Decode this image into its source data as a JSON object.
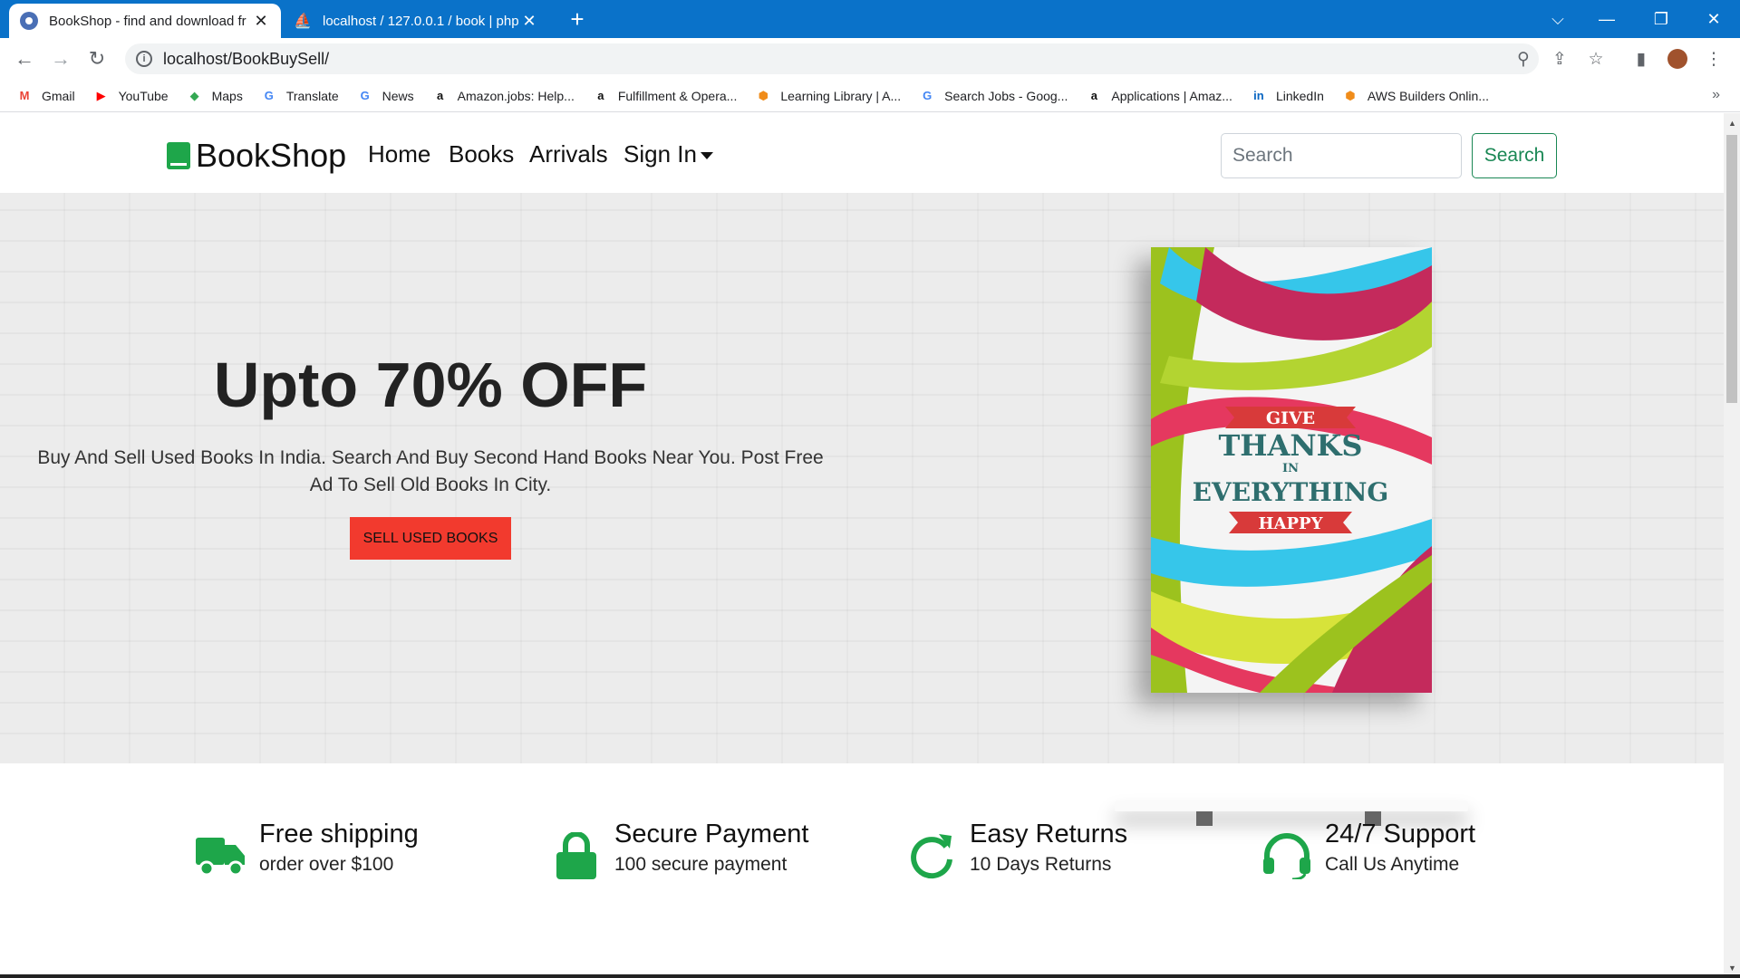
{
  "browser": {
    "tabs": [
      {
        "title": "BookShop - find and download fr",
        "active": true
      },
      {
        "title": "localhost / 127.0.0.1 / book | php",
        "active": false
      }
    ],
    "new_tab": "+",
    "close_glyph": "✕",
    "url": "localhost/BookBuySell/",
    "bookmarks": [
      {
        "label": "Gmail",
        "icon": "gmail-icon",
        "glyph": "M",
        "color": "#ea4335"
      },
      {
        "label": "YouTube",
        "icon": "youtube-icon",
        "glyph": "▶",
        "color": "#ff0000"
      },
      {
        "label": "Maps",
        "icon": "maps-icon",
        "glyph": "◆",
        "color": "#34a853"
      },
      {
        "label": "Translate",
        "icon": "translate-icon",
        "glyph": "G",
        "color": "#4285f4"
      },
      {
        "label": "News",
        "icon": "news-icon",
        "glyph": "G",
        "color": "#4285f4"
      },
      {
        "label": "Amazon.jobs: Help...",
        "icon": "amazon-icon",
        "glyph": "a",
        "color": "#111111"
      },
      {
        "label": "Fulfillment & Opera...",
        "icon": "amazon-icon",
        "glyph": "a",
        "color": "#111111"
      },
      {
        "label": "Learning Library | A...",
        "icon": "aws-cube-icon",
        "glyph": "⬢",
        "color": "#f08c1a"
      },
      {
        "label": "Search Jobs - Goog...",
        "icon": "google-icon",
        "glyph": "G",
        "color": "#4285f4"
      },
      {
        "label": "Applications | Amaz...",
        "icon": "amazon-icon",
        "glyph": "a",
        "color": "#111111"
      },
      {
        "label": "LinkedIn",
        "icon": "linkedin-icon",
        "glyph": "in",
        "color": "#0a66c2"
      },
      {
        "label": "AWS Builders Onlin...",
        "icon": "aws-cube-icon",
        "glyph": "⬢",
        "color": "#f08c1a"
      }
    ],
    "more_glyph": "»"
  },
  "site": {
    "brand": "BookShop",
    "nav": [
      "Home",
      "Books",
      "Arrivals",
      "Sign In"
    ],
    "search_placeholder": "Search",
    "search_button": "Search",
    "hero": {
      "title": "Upto 70% OFF",
      "subtitle": "Buy And Sell Used Books In India. Search And Buy Second Hand Books Near You. Post Free Ad To Sell Old Books In City.",
      "button": "SELL USED BOOKS",
      "book_cover": {
        "line1": "GIVE",
        "line2": "THANKS",
        "line3": "IN",
        "line4": "EVERYTHING",
        "line5": "HAPPY"
      }
    },
    "features": [
      {
        "title": "Free shipping",
        "subtitle": "order over $100",
        "icon": "truck-icon"
      },
      {
        "title": "Secure Payment",
        "subtitle": "100 secure payment",
        "icon": "lock-icon"
      },
      {
        "title": "Easy Returns",
        "subtitle": "10 Days Returns",
        "icon": "redo-icon"
      },
      {
        "title": "24/7 Support",
        "subtitle": "Call Us Anytime",
        "icon": "headset-icon"
      }
    ],
    "accent_color": "#1ea64a",
    "button_color": "#f23a2e"
  }
}
